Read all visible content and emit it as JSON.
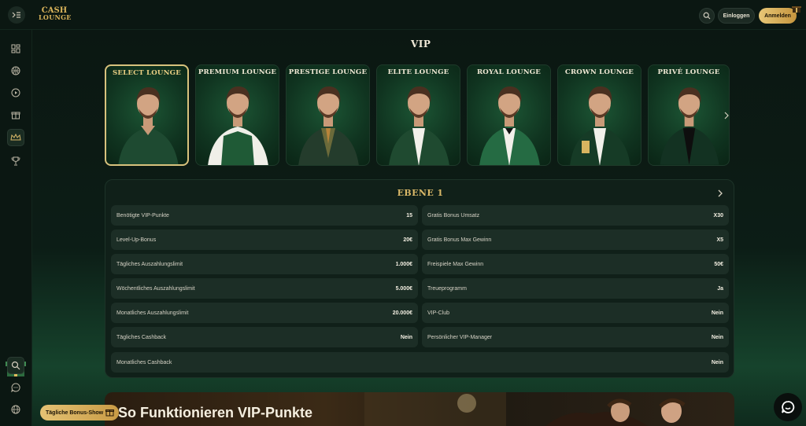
{
  "header": {
    "logo_line1": "CASH",
    "logo_line2": "LOUNGE",
    "login_label": "Einloggen",
    "register_label": "Anmelden"
  },
  "page": {
    "title": "VIP"
  },
  "lounges": [
    {
      "label": "SELECT LOUNGE",
      "selected": true
    },
    {
      "label": "PREMIUM LOUNGE",
      "selected": false
    },
    {
      "label": "PRESTIGE LOUNGE",
      "selected": false
    },
    {
      "label": "ELITE LOUNGE",
      "selected": false
    },
    {
      "label": "ROYAL LOUNGE",
      "selected": false
    },
    {
      "label": "CROWN LOUNGE",
      "selected": false
    },
    {
      "label": "PRIVÉ LOUNGE",
      "selected": false
    }
  ],
  "level": {
    "title": "EBENE 1",
    "left": [
      {
        "label": "Benötigte VIP-Punkte",
        "value": "15"
      },
      {
        "label": "Level-Up-Bonus",
        "value": "20€"
      },
      {
        "label": "Tägliches Auszahlungslimit",
        "value": "1.000€"
      },
      {
        "label": "Wöchentliches Auszahlungslimit",
        "value": "5.000€"
      },
      {
        "label": "Monatliches Auszahlungslimit",
        "value": "20.000€"
      },
      {
        "label": "Tägliches Cashback",
        "value": "Nein"
      }
    ],
    "right": [
      {
        "label": "Gratis Bonus Umsatz",
        "value": "X30"
      },
      {
        "label": "Gratis Bonus Max Gewinn",
        "value": "X5"
      },
      {
        "label": "Freispiele Max Gewinn",
        "value": "50€"
      },
      {
        "label": "Treueprogramm",
        "value": "Ja"
      },
      {
        "label": "VIP-Club",
        "value": "Nein"
      },
      {
        "label": "Persönlicher VIP-Manager",
        "value": "Nein"
      }
    ],
    "full": {
      "label": "Monatliches Cashback",
      "value": "Nein"
    }
  },
  "banner": {
    "title": "So Funktionieren VIP-Punkte"
  },
  "bonus_show_label": "Tägliche Bonus-Show",
  "sidebar_icons": [
    "grid-icon",
    "basketball-icon",
    "play-icon",
    "gift-icon",
    "crown-icon",
    "trophy-icon",
    "search-icon",
    "chat-icon",
    "globe-icon"
  ],
  "colors": {
    "gold": "#d9b868",
    "panel": "#102019",
    "row": "#1c2e26"
  }
}
